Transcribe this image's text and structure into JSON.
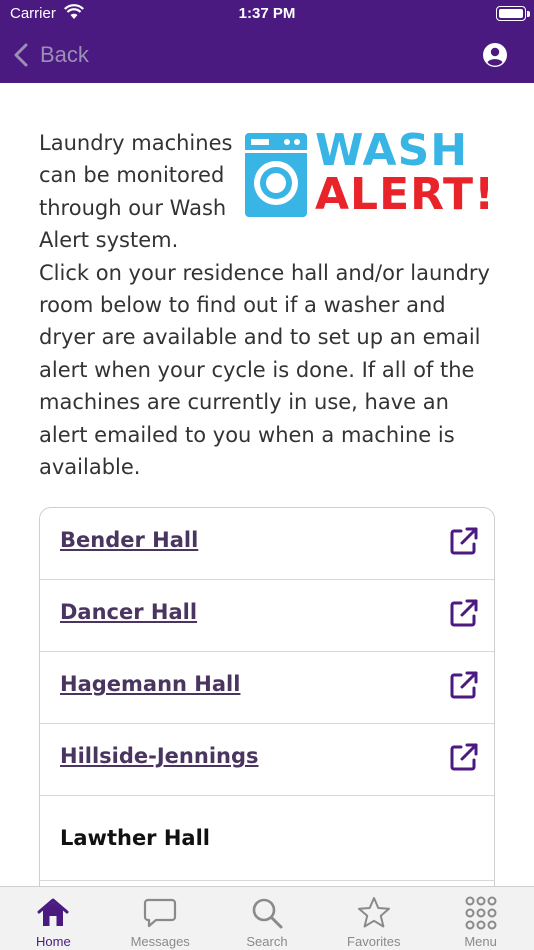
{
  "status_bar": {
    "carrier": "Carrier",
    "time": "1:37 PM"
  },
  "nav": {
    "back_label": "Back"
  },
  "logo": {
    "line1": "WASH",
    "line2": "ALERT!"
  },
  "intro": {
    "text": "Laundry machines can be monitored through our Wash Alert system. Click on your residence hall and/or laundry room below to find out if a washer and dryer are available and to set up an email alert when your cycle is done. If all of the machines are currently in use, have an alert emailed to you when a machine is available."
  },
  "halls": [
    {
      "label": "Bender Hall",
      "external": true
    },
    {
      "label": "Dancer Hall",
      "external": true
    },
    {
      "label": "Hagemann Hall",
      "external": true
    },
    {
      "label": "Hillside-Jennings",
      "external": true
    },
    {
      "label": "Lawther Hall",
      "external": false
    }
  ],
  "tabs": [
    {
      "label": "Home",
      "icon": "home-icon",
      "active": true
    },
    {
      "label": "Messages",
      "icon": "messages-icon",
      "active": false
    },
    {
      "label": "Search",
      "icon": "search-icon",
      "active": false
    },
    {
      "label": "Favorites",
      "icon": "star-icon",
      "active": false
    },
    {
      "label": "Menu",
      "icon": "grid-menu-icon",
      "active": false
    }
  ],
  "colors": {
    "brand": "#4b1a80",
    "link": "#4a3560",
    "wash": "#38b4e5",
    "alert": "#e8232a"
  }
}
